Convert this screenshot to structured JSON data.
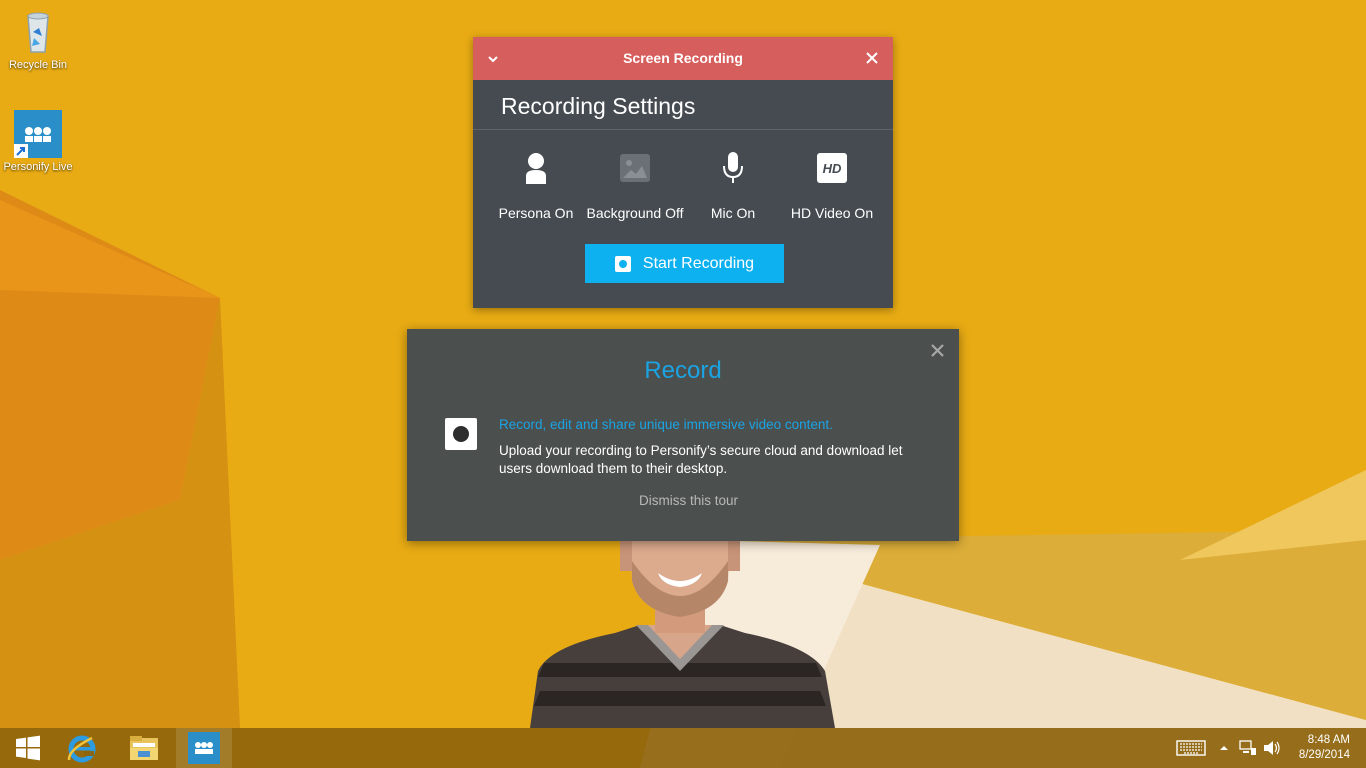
{
  "desktop": {
    "icons": [
      {
        "label": "Recycle Bin",
        "icon": "recycle-bin-icon"
      },
      {
        "label": "Personify Live",
        "icon": "personify-live-icon"
      }
    ]
  },
  "recording_panel": {
    "title": "Screen Recording",
    "heading": "Recording Settings",
    "options": [
      {
        "label": "Persona On",
        "icon": "persona-icon",
        "state": "on"
      },
      {
        "label": "Background Off",
        "icon": "background-image-icon",
        "state": "off"
      },
      {
        "label": "Mic On",
        "icon": "microphone-icon",
        "state": "on"
      },
      {
        "label": "HD Video On",
        "icon": "hd-icon",
        "state": "on"
      }
    ],
    "start_button": "Start Recording",
    "colors": {
      "titlebar": "#d65e5c",
      "body": "#454b51",
      "accent": "#0db1f0"
    }
  },
  "tour": {
    "title": "Record",
    "headline": "Record, edit and share unique immersive video content.",
    "body": "Upload your recording to Personify’s secure cloud and download let users download them to their desktop.",
    "dismiss": "Dismiss this tour",
    "colors": {
      "accent": "#1ba3e3",
      "background": "#4b504f"
    }
  },
  "taskbar": {
    "items": [
      "start-icon",
      "internet-explorer-icon",
      "file-explorer-icon",
      "personify-live-icon"
    ],
    "tray": [
      "keyboard-icon",
      "show-hidden-icons-chevron",
      "network-icon",
      "volume-icon"
    ],
    "time": "8:48 AM",
    "date": "8/29/2014"
  }
}
